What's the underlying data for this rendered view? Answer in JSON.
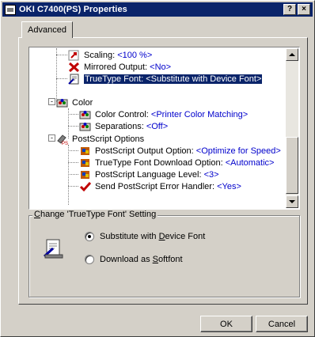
{
  "window": {
    "title": "OKI C7400(PS) Properties",
    "help_button": "?",
    "close_button": "×"
  },
  "tabs": [
    {
      "label": "Advanced"
    }
  ],
  "tree": {
    "items": [
      {
        "label": "Scaling: ",
        "value": "<100 %>"
      },
      {
        "label": "Mirrored Output: ",
        "value": "<No>"
      },
      {
        "label": "TrueType Font: ",
        "value": "<Substitute with Device Font>"
      },
      {
        "label": "Color",
        "value": ""
      },
      {
        "label": "Color Control: ",
        "value": "<Printer Color Matching>"
      },
      {
        "label": "Separations: ",
        "value": "<Off>"
      },
      {
        "label": "PostScript Options",
        "value": ""
      },
      {
        "label": "PostScript Output Option: ",
        "value": "<Optimize for Speed>"
      },
      {
        "label": "TrueType Font Download Option: ",
        "value": "<Automatic>"
      },
      {
        "label": "PostScript Language Level: ",
        "value": "<3>"
      },
      {
        "label": "Send PostScript Error Handler: ",
        "value": "<Yes>"
      }
    ],
    "expanders": [
      "-",
      "-"
    ],
    "selected_index": 2
  },
  "setting": {
    "title_prefix": "C",
    "title_rest": "hange 'TrueType Font' Setting",
    "options": [
      {
        "pre": "Substitute with ",
        "u": "D",
        "post": "evice Font",
        "checked": true
      },
      {
        "pre": "Download as ",
        "u": "S",
        "post": "oftfont",
        "checked": false
      }
    ]
  },
  "buttons": {
    "ok": "OK",
    "cancel": "Cancel"
  }
}
